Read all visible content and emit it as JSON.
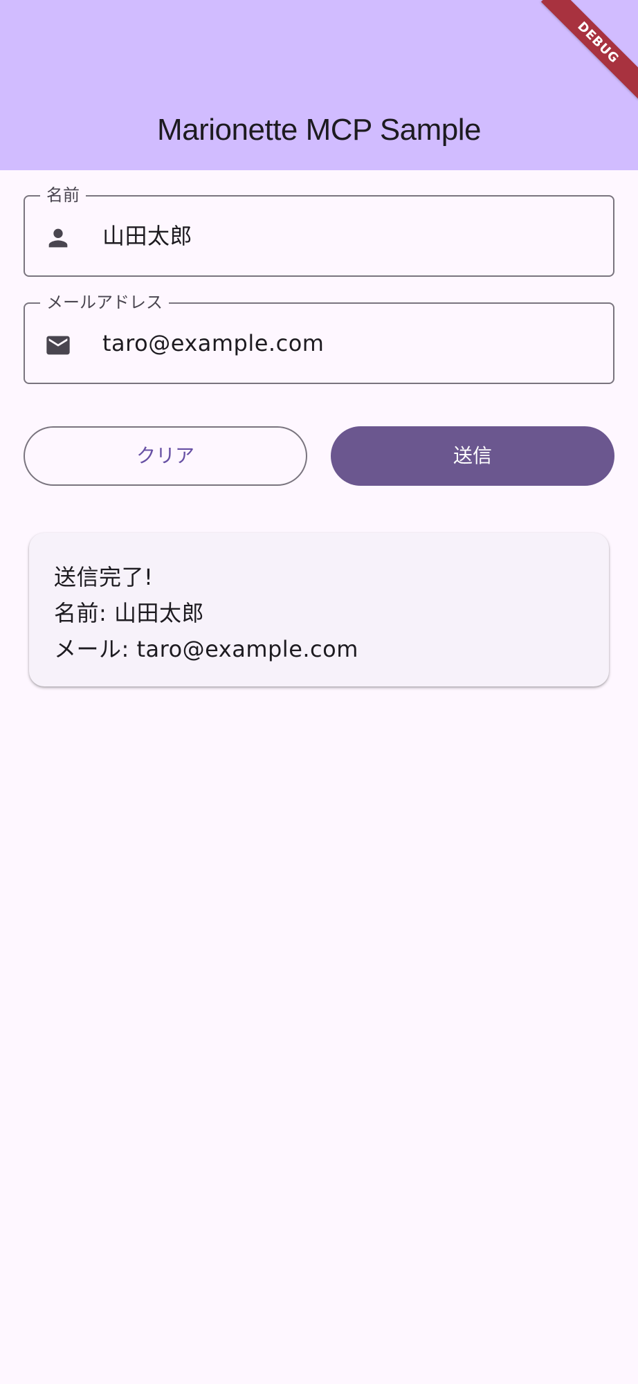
{
  "app_bar": {
    "title": "Marionette MCP Sample",
    "background": "#D1BCFF"
  },
  "debug_banner": {
    "label": "DEBUG",
    "color": "#A8323F"
  },
  "form": {
    "name_field": {
      "label": "名前",
      "value": "山田太郎",
      "icon": "person-icon"
    },
    "email_field": {
      "label": "メールアドレス",
      "value": "taro@example.com",
      "icon": "mail-icon"
    }
  },
  "buttons": {
    "clear_label": "クリア",
    "submit_label": "送信",
    "submit_color": "#6B578F"
  },
  "result": {
    "status": "送信完了!",
    "name_line": "名前: 山田太郎",
    "email_line": "メール: taro@example.com"
  }
}
